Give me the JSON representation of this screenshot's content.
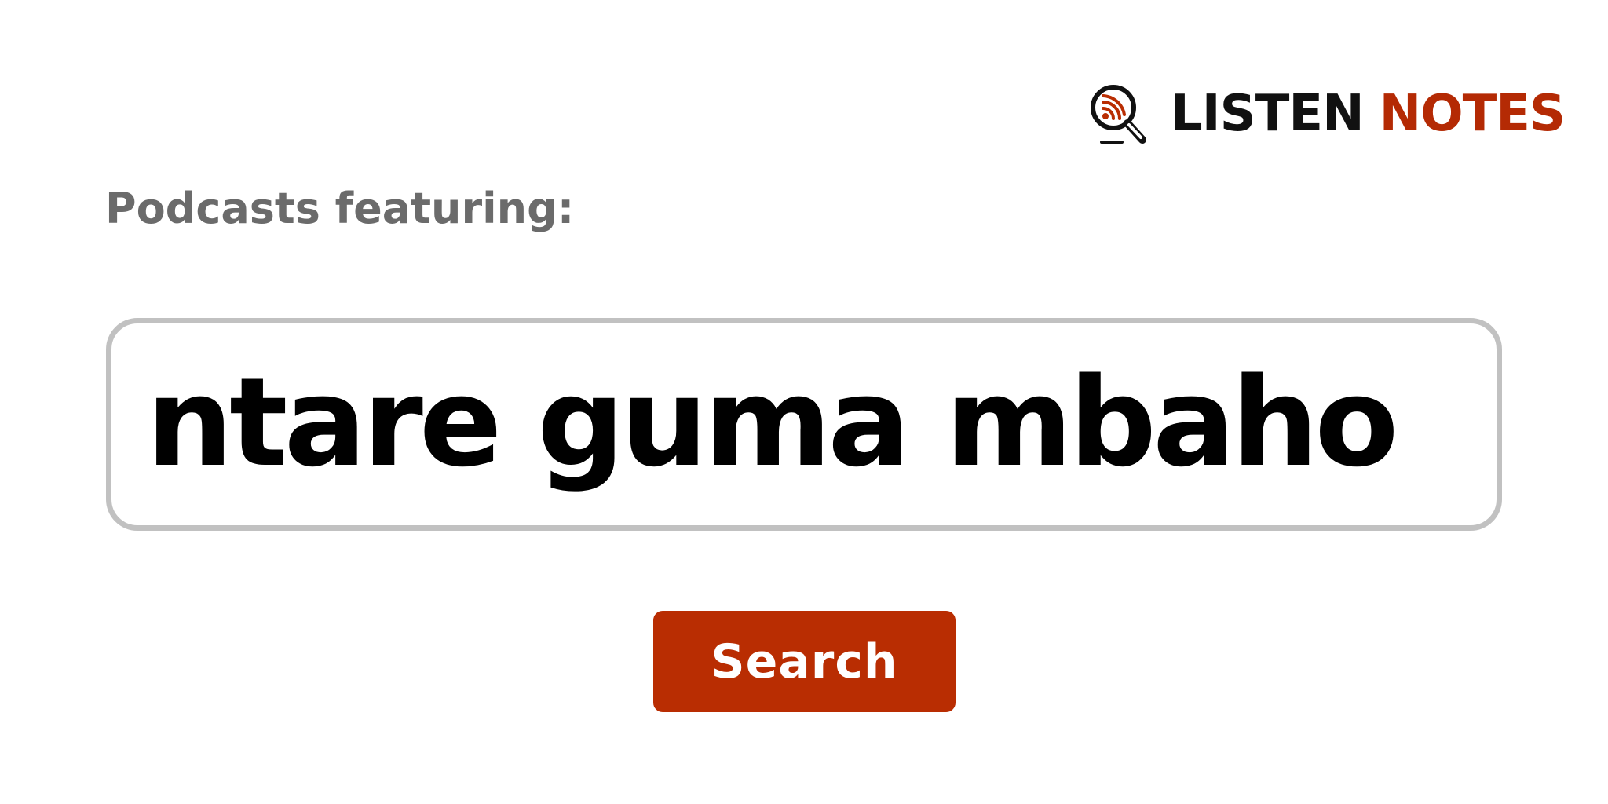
{
  "brand": {
    "name_part1": "LISTEN",
    "name_part2": "NOTES",
    "icon": "magnifier-rss-icon",
    "colors": {
      "accent": "#b92d02",
      "dark": "#111111"
    }
  },
  "label": {
    "text": "Podcasts featuring:"
  },
  "search": {
    "query": "ntare guma mbaho",
    "border_color": "#c1c1c1"
  },
  "button": {
    "label": "Search",
    "color": "#b92d02"
  }
}
